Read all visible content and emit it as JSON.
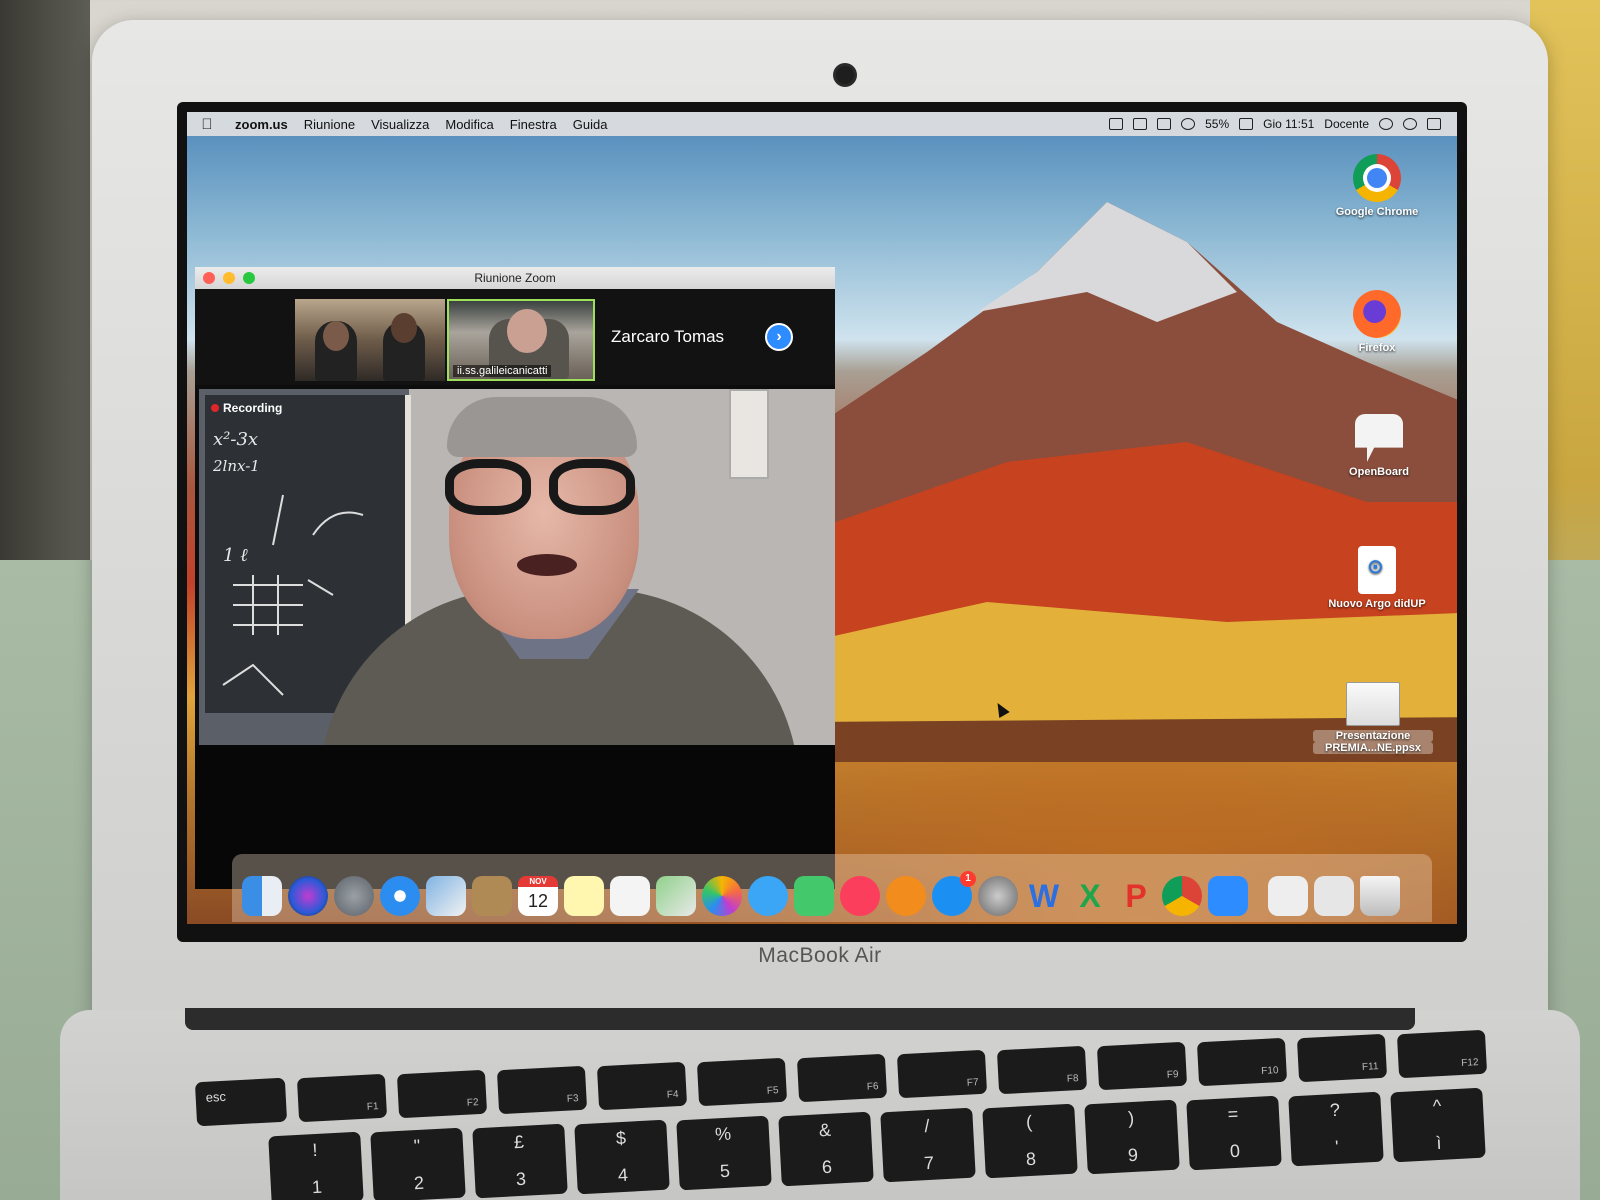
{
  "menubar": {
    "apple": "",
    "app_name": "zoom.us",
    "menus": [
      "Riunione",
      "Visualizza",
      "Modifica",
      "Finestra",
      "Guida"
    ],
    "battery": "55%",
    "clock": "Gio 11:51",
    "user": "Docente"
  },
  "desktop_icons": {
    "chrome": "Google Chrome",
    "firefox": "Firefox",
    "openboard": "OpenBoard",
    "argo": "Nuovo Argo didUP",
    "ppt_line1": "Presentazione",
    "ppt_line2": "PREMIA...NE.ppsx"
  },
  "zoom": {
    "window_title": "Riunione Zoom",
    "thumbnail_name": "ii.ss.galileicanicatti",
    "active_speaker": "Zarcaro Tomas",
    "next_icon": "›",
    "recording_label": "Recording"
  },
  "board": {
    "line1": "x²-3x",
    "line2": "2lnx-1",
    "line3": "1   ℓ"
  },
  "dock": {
    "calendar_month": "NOV",
    "calendar_day": "12",
    "appstore_badge": "1",
    "word": "W",
    "excel": "X",
    "powerpoint": "P"
  },
  "laptop": {
    "brand": "MacBook Air"
  },
  "keyboard": {
    "esc": "esc",
    "f1": "F1",
    "f2": "F2",
    "f3": "F3",
    "f4": "F4",
    "f5": "F5",
    "f6": "F6",
    "f7": "F7",
    "f8": "F8",
    "f9": "F9",
    "f10": "F10",
    "f11": "F11",
    "f12": "F12",
    "row2": [
      {
        "top": "!",
        "bot": "1"
      },
      {
        "top": "\"",
        "bot": "2"
      },
      {
        "top": "£",
        "bot": "3"
      },
      {
        "top": "$",
        "bot": "4"
      },
      {
        "top": "%",
        "bot": "5"
      },
      {
        "top": "&",
        "bot": "6"
      },
      {
        "top": "/",
        "bot": "7"
      },
      {
        "top": "(",
        "bot": "8"
      },
      {
        "top": ")",
        "bot": "9"
      },
      {
        "top": "=",
        "bot": "0"
      },
      {
        "top": "?",
        "bot": "'"
      },
      {
        "top": "^",
        "bot": "ì"
      }
    ]
  }
}
